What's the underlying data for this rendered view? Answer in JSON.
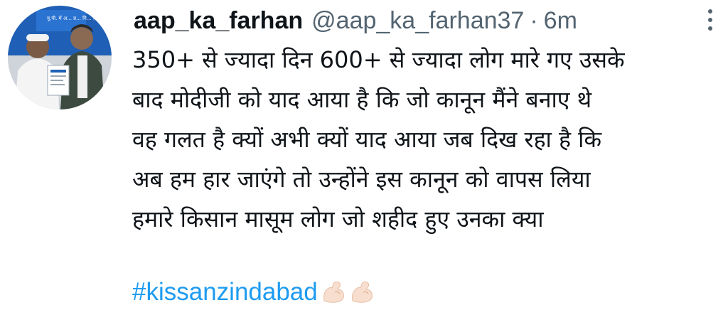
{
  "tweet": {
    "display_name": "aap_ka_farhan",
    "handle": "@aap_ka_farhan37",
    "separator": "·",
    "time": "6m",
    "lines": [
      "350+ से ज्यादा दिन 600+ से ज्यादा लोग मारे गए उसके",
      "बाद मोदीजी को  याद आया है कि जो कानून मैंने बनाए थे",
      "वह गलत है क्यों अभी क्यों याद आया जब दिख रहा है कि",
      "अब हम हार जाएंगे  तो उन्होंने इस कानून को वापस लिया",
      "हमारे किसान मासूम लोग जो शहीद हुए उनका क्या"
    ],
    "hashtag": "#kissanzindabad",
    "emoji": [
      "flexed-biceps-light-skin-icon",
      "flexed-biceps-light-skin-icon"
    ],
    "avatar_banner_text": "यू.पी. में अ... प्र... गि... फ़ी बिजली, ..."
  },
  "colors": {
    "text": "#0f1419",
    "secondary": "#536471",
    "link": "#1d9bf0"
  },
  "icons": {
    "more": "more-horizontal-icon"
  }
}
